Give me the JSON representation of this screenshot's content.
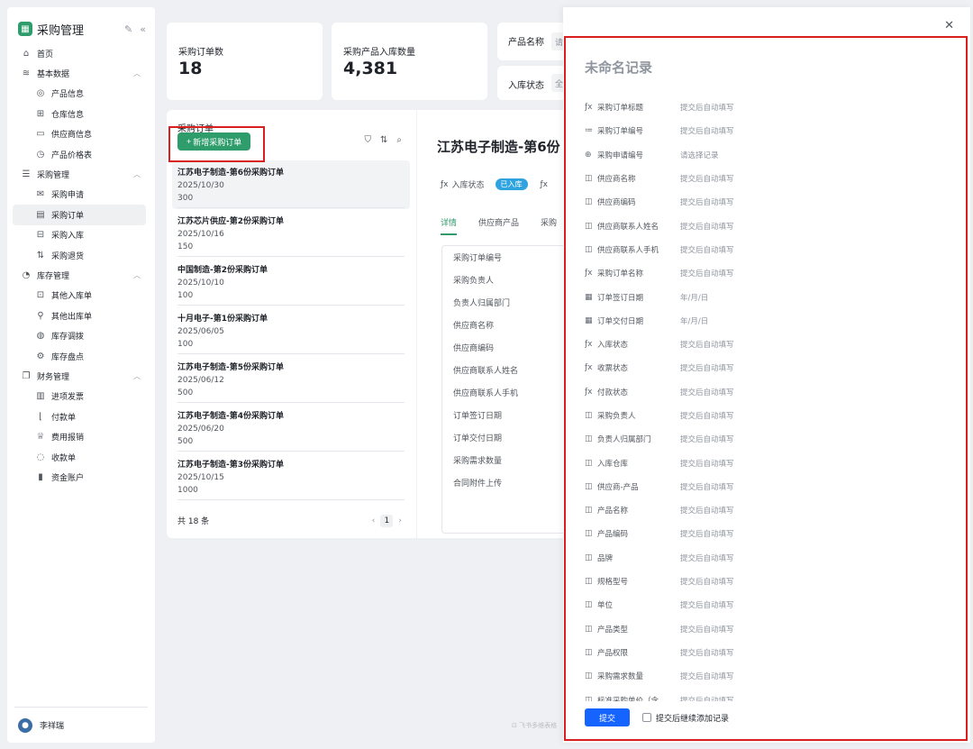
{
  "app": {
    "name": "采购管理",
    "logo_icon": "grid-icon"
  },
  "nav": [
    {
      "label": "首页",
      "icon": "home-icon",
      "level": 0
    },
    {
      "label": "基本数据",
      "icon": "layers-icon",
      "level": 0,
      "group": true
    },
    {
      "label": "产品信息",
      "icon": "globe-icon",
      "level": 1
    },
    {
      "label": "仓库信息",
      "icon": "warehouse-icon",
      "level": 1
    },
    {
      "label": "供应商信息",
      "icon": "monitor-icon",
      "level": 1
    },
    {
      "label": "产品价格表",
      "icon": "price-icon",
      "level": 1
    },
    {
      "label": "采购管理",
      "icon": "database-icon",
      "level": 0,
      "group": true
    },
    {
      "label": "采购申请",
      "icon": "mail-icon",
      "level": 1
    },
    {
      "label": "采购订单",
      "icon": "calendar-icon",
      "level": 1,
      "active": true
    },
    {
      "label": "采购入库",
      "icon": "inbox-icon",
      "level": 1
    },
    {
      "label": "采购退货",
      "icon": "return-icon",
      "level": 1
    },
    {
      "label": "库存管理",
      "icon": "clock-icon",
      "level": 0,
      "group": true
    },
    {
      "label": "其他入库单",
      "icon": "doc-in-icon",
      "level": 1
    },
    {
      "label": "其他出库单",
      "icon": "pin-icon",
      "level": 1
    },
    {
      "label": "库存调拨",
      "icon": "transfer-icon",
      "level": 1
    },
    {
      "label": "库存盘点",
      "icon": "settings-icon",
      "level": 1
    },
    {
      "label": "财务管理",
      "icon": "copy-icon",
      "level": 0,
      "group": true
    },
    {
      "label": "进项发票",
      "icon": "barcode-icon",
      "level": 1
    },
    {
      "label": "付款单",
      "icon": "chart-icon",
      "level": 1
    },
    {
      "label": "费用报销",
      "icon": "trophy-icon",
      "level": 1
    },
    {
      "label": "收款单",
      "icon": "bulb-icon",
      "level": 1
    },
    {
      "label": "资金账户",
      "icon": "bar-chart-icon",
      "level": 1
    }
  ],
  "user": {
    "name": "李祥瑞"
  },
  "stats": [
    {
      "label": "采购订单数",
      "value": "18"
    },
    {
      "label": "采购产品入库数量",
      "value": "4,381"
    }
  ],
  "filters": [
    {
      "label": "产品名称",
      "value": "请"
    },
    {
      "label": "入库状态",
      "value": "全"
    }
  ],
  "list": {
    "title": "采购订单",
    "new_button": "新增采购订单",
    "orders": [
      {
        "name": "江苏电子制造-第6份采购订单",
        "date": "2025/10/30",
        "qty": "300"
      },
      {
        "name": "江苏芯片供应-第2份采购订单",
        "date": "2025/10/16",
        "qty": "150"
      },
      {
        "name": "中国制造-第2份采购订单",
        "date": "2025/10/10",
        "qty": "100"
      },
      {
        "name": "十月电子-第1份采购订单",
        "date": "2025/06/05",
        "qty": "100"
      },
      {
        "name": "江苏电子制造-第5份采购订单",
        "date": "2025/06/12",
        "qty": "500"
      },
      {
        "name": "江苏电子制造-第4份采购订单",
        "date": "2025/06/20",
        "qty": "500"
      },
      {
        "name": "江苏电子制造-第3份采购订单",
        "date": "2025/10/15",
        "qty": "1000"
      }
    ],
    "total": "共 18 条",
    "page": "1"
  },
  "detail": {
    "title": "江苏电子制造-第6份",
    "status_label": "入库状态",
    "status_value": "已入库",
    "tabs": [
      "详情",
      "供应商产品",
      "采购"
    ],
    "fields": [
      "采购订单编号",
      "采购负责人",
      "负责人归属部门",
      "供应商名称",
      "供应商编码",
      "供应商联系人姓名",
      "供应商联系人手机",
      "订单签订日期",
      "订单交付日期",
      "采购需求数量",
      "合同附件上传"
    ]
  },
  "drawer": {
    "title": "未命名记录",
    "fields": [
      {
        "label": "采购订单标题",
        "value": "提交后自动填写",
        "icon": "formula-icon"
      },
      {
        "label": "采购订单编号",
        "value": "提交后自动填写",
        "icon": "list-number-icon"
      },
      {
        "label": "采购申请编号",
        "value": "请选择记录",
        "icon": "link-icon"
      },
      {
        "label": "供应商名称",
        "value": "提交后自动填写",
        "icon": "lookup-icon"
      },
      {
        "label": "供应商编码",
        "value": "提交后自动填写",
        "icon": "lookup-icon"
      },
      {
        "label": "供应商联系人姓名",
        "value": "提交后自动填写",
        "icon": "lookup-icon"
      },
      {
        "label": "供应商联系人手机",
        "value": "提交后自动填写",
        "icon": "lookup-icon"
      },
      {
        "label": "采购订单名称",
        "value": "提交后自动填写",
        "icon": "formula-icon"
      },
      {
        "label": "订单签订日期",
        "value": "年/月/日",
        "icon": "date-icon"
      },
      {
        "label": "订单交付日期",
        "value": "年/月/日",
        "icon": "date-icon"
      },
      {
        "label": "入库状态",
        "value": "提交后自动填写",
        "icon": "formula-icon"
      },
      {
        "label": "收票状态",
        "value": "提交后自动填写",
        "icon": "formula-icon"
      },
      {
        "label": "付款状态",
        "value": "提交后自动填写",
        "icon": "formula-icon"
      },
      {
        "label": "采购负责人",
        "value": "提交后自动填写",
        "icon": "lookup-icon"
      },
      {
        "label": "负责人归属部门",
        "value": "提交后自动填写",
        "icon": "lookup-icon"
      },
      {
        "label": "入库仓库",
        "value": "提交后自动填写",
        "icon": "lookup-icon"
      },
      {
        "label": "供应商-产品",
        "value": "提交后自动填写",
        "icon": "lookup-icon"
      },
      {
        "label": "产品名称",
        "value": "提交后自动填写",
        "icon": "lookup-icon"
      },
      {
        "label": "产品编码",
        "value": "提交后自动填写",
        "icon": "lookup-icon"
      },
      {
        "label": "品牌",
        "value": "提交后自动填写",
        "icon": "lookup-icon"
      },
      {
        "label": "规格型号",
        "value": "提交后自动填写",
        "icon": "lookup-icon"
      },
      {
        "label": "单位",
        "value": "提交后自动填写",
        "icon": "lookup-icon"
      },
      {
        "label": "产品类型",
        "value": "提交后自动填写",
        "icon": "lookup-icon"
      },
      {
        "label": "产品权限",
        "value": "提交后自动填写",
        "icon": "lookup-icon"
      },
      {
        "label": "采购需求数量",
        "value": "提交后自动填写",
        "icon": "lookup-icon"
      },
      {
        "label": "标准采购单价（含",
        "value": "提交后自动填写",
        "icon": "lookup-icon"
      }
    ],
    "submit": "提交",
    "continue_label": "提交后继续添加记录"
  },
  "watermark": "飞书多维表格"
}
